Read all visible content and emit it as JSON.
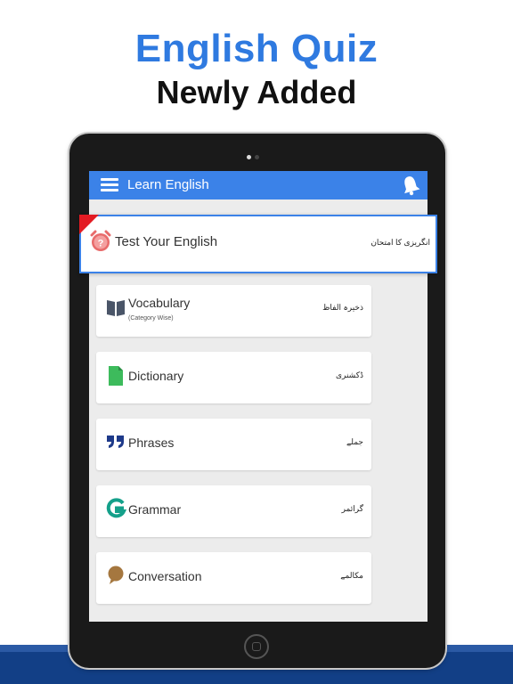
{
  "promo": {
    "headline": "English Quiz",
    "subheadline": "Newly Added"
  },
  "app": {
    "title": "Learn English"
  },
  "featured": {
    "label": "Test Your English",
    "urdu": "انگریزی کا امتحان"
  },
  "items": [
    {
      "label": "Vocabulary",
      "sublabel": "(Category Wise)",
      "urdu": "ذخیرہ الفاظ",
      "icon": "book-icon"
    },
    {
      "label": "Dictionary",
      "urdu": "ڈکشنری",
      "icon": "document-icon"
    },
    {
      "label": "Phrases",
      "urdu": "جملے",
      "icon": "quote-icon"
    },
    {
      "label": "Grammar",
      "urdu": "گرائمر",
      "icon": "grammar-g-icon"
    },
    {
      "label": "Conversation",
      "urdu": "مکالمے",
      "icon": "speech-bubble-icon"
    }
  ],
  "colors": {
    "accent": "#3b82e8",
    "headline": "#2f7ae0",
    "badge": "#e31b23",
    "band": "#123f86"
  }
}
